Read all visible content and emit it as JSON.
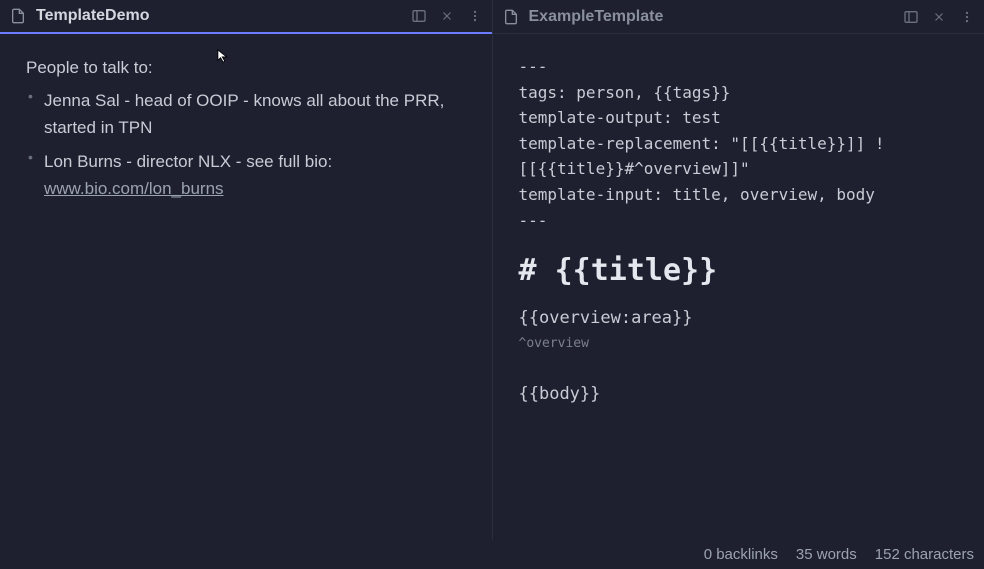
{
  "leftPane": {
    "title": "TemplateDemo",
    "heading": "People to talk to:",
    "items": [
      {
        "text": "Jenna Sal - head of OOIP - knows all about the PRR, started in TPN"
      },
      {
        "textPrefix": "Lon Burns - director NLX - see full bio: ",
        "linkText": "www.bio.com/lon_burns"
      }
    ]
  },
  "rightPane": {
    "title": "ExampleTemplate",
    "frontmatter": {
      "open": "---",
      "l1": "tags: person, {{tags}}",
      "l2": "template-output: test",
      "l3": "template-replacement: \"[[{{title}}]] ![[{{title}}#^overview]]\"",
      "l4": "template-input: title, overview, body",
      "close": "---"
    },
    "h1": "# {{title}}",
    "overview": "{{overview:area}}",
    "overviewCaret": "^overview",
    "body": "{{body}}"
  },
  "status": {
    "backlinks": "0 backlinks",
    "words": "35 words",
    "chars": "152 characters"
  }
}
